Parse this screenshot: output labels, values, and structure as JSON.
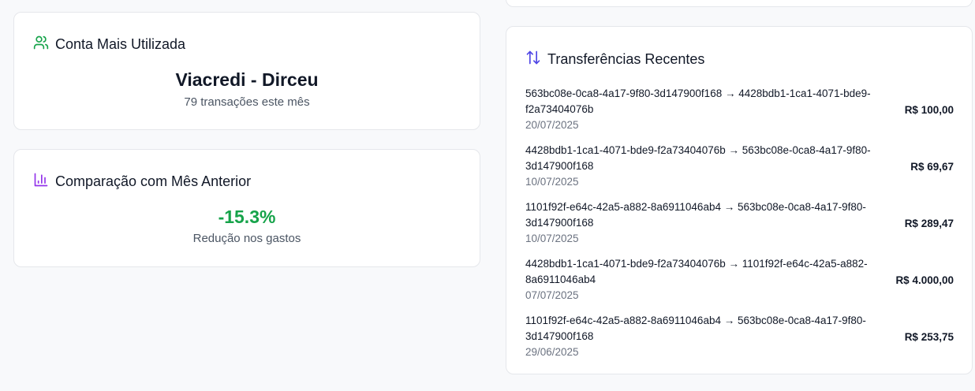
{
  "most_used_account": {
    "title": "Conta Mais Utilizada",
    "icon": "users-icon",
    "account_name": "Viacredi - Dirceu",
    "subtitle": "79 transações este mês",
    "icon_color": "#16a34a"
  },
  "comparison": {
    "title": "Comparação com Mês Anterior",
    "icon": "bar-chart-icon",
    "percent": "-15.3%",
    "subtitle": "Redução nos gastos",
    "icon_color": "#9333ea",
    "percent_color": "#16a34a"
  },
  "recent_transfers": {
    "title": "Transferências Recentes",
    "icon": "arrows-up-down-icon",
    "icon_color": "#4f46e5",
    "items": [
      {
        "description": "563bc08e-0ca8-4a17-9f80-3d147900f168 → 4428bdb1-1ca1-4071-bde9-f2a73404076b",
        "date": "20/07/2025",
        "amount": "R$ 100,00"
      },
      {
        "description": "4428bdb1-1ca1-4071-bde9-f2a73404076b → 563bc08e-0ca8-4a17-9f80-3d147900f168",
        "date": "10/07/2025",
        "amount": "R$ 69,67"
      },
      {
        "description": "1101f92f-e64c-42a5-a882-8a6911046ab4 → 563bc08e-0ca8-4a17-9f80-3d147900f168",
        "date": "10/07/2025",
        "amount": "R$ 289,47"
      },
      {
        "description": "4428bdb1-1ca1-4071-bde9-f2a73404076b → 1101f92f-e64c-42a5-a882-8a6911046ab4",
        "date": "07/07/2025",
        "amount": "R$ 4.000,00"
      },
      {
        "description": "1101f92f-e64c-42a5-a882-8a6911046ab4 → 563bc08e-0ca8-4a17-9f80-3d147900f168",
        "date": "29/06/2025",
        "amount": "R$ 253,75"
      }
    ]
  }
}
